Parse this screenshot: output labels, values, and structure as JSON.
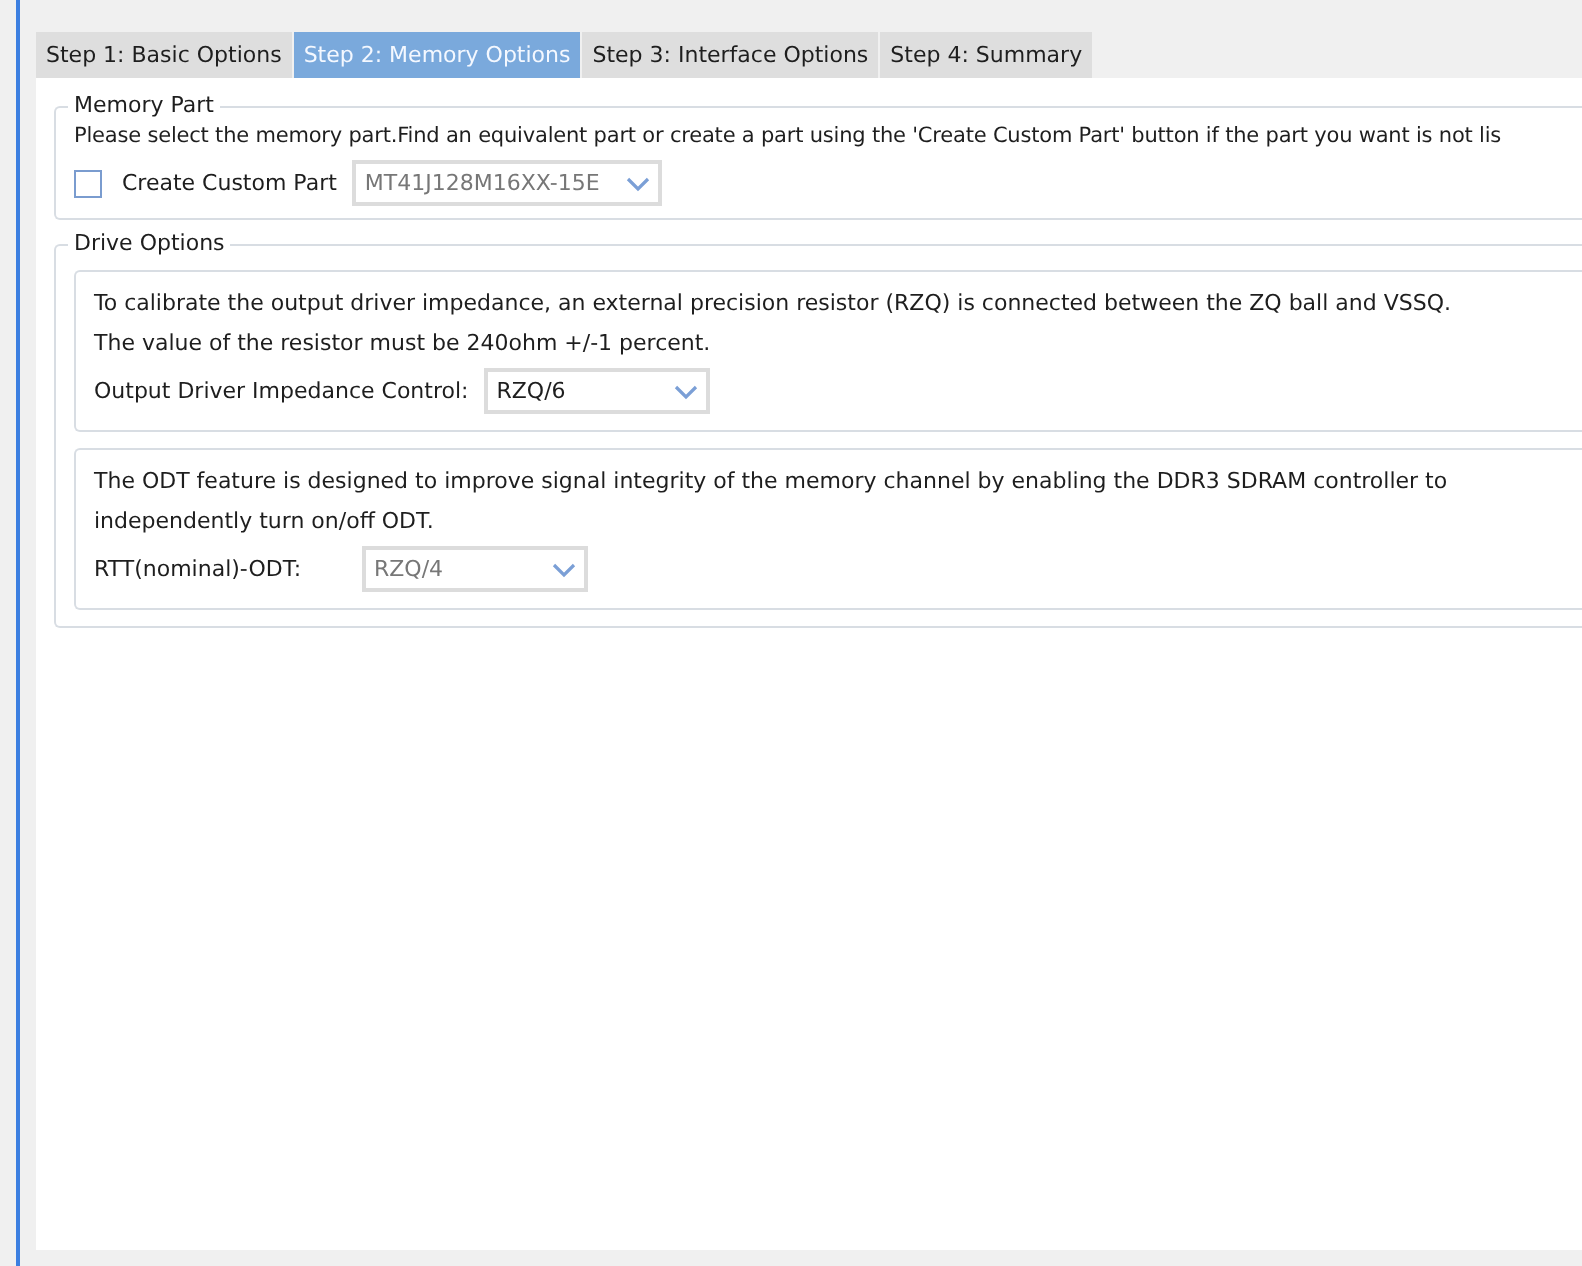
{
  "tabs": [
    {
      "label": "Step 1: Basic Options",
      "selected": false
    },
    {
      "label": "Step 2: Memory Options",
      "selected": true
    },
    {
      "label": "Step 3: Interface Options",
      "selected": false
    },
    {
      "label": "Step 4: Summary",
      "selected": false
    }
  ],
  "memory_part": {
    "title": "Memory Part",
    "description": "Please select the memory part.Find an equivalent part or create a part using the 'Create Custom Part' button if the part you want is not lis",
    "checkbox": {
      "label": "Create Custom Part",
      "checked": false
    },
    "combo": {
      "value": "MT41J128M16XX-15E",
      "disabled": true
    }
  },
  "drive_options": {
    "title": "Drive Options",
    "groups": [
      {
        "lines": [
          "To calibrate the output driver impedance, an external precision resistor (RZQ) is connected between the ZQ ball and VSSQ.",
          "The value of the resistor must be 240ohm +/-1 percent."
        ],
        "label": "Output Driver Impedance Control:",
        "combo": {
          "value": "RZQ/6",
          "disabled": false
        }
      },
      {
        "lines": [
          "The ODT feature is designed to improve signal integrity of the memory channel by enabling the DDR3 SDRAM controller to",
          "independently turn on/off ODT."
        ],
        "label": "RTT(nominal)-ODT:",
        "combo": {
          "value": "RZQ/4",
          "disabled": true
        }
      }
    ]
  }
}
